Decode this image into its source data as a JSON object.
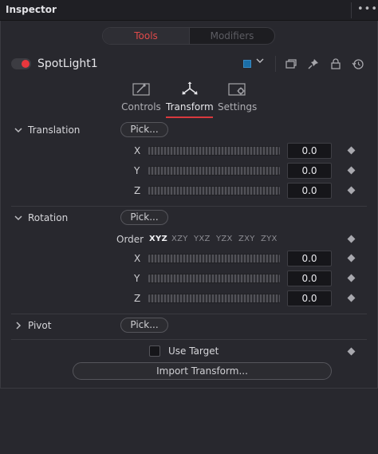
{
  "header": {
    "title": "Inspector",
    "menu": "•••"
  },
  "segmented": {
    "tools_label": "Tools",
    "modifiers_label": "Modifiers"
  },
  "node": {
    "name": "SpotLight1",
    "enabled": true,
    "chip_color": "#1b6fa8"
  },
  "sub_tabs": [
    {
      "label": "Controls",
      "icon": "controls-icon"
    },
    {
      "label": "Transform",
      "icon": "transform-icon",
      "active": true
    },
    {
      "label": "Settings",
      "icon": "settings-icon"
    }
  ],
  "translation": {
    "label": "Translation",
    "pick_label": "Pick...",
    "expanded": true,
    "rows": [
      {
        "axis": "X",
        "value": "0.0"
      },
      {
        "axis": "Y",
        "value": "0.0"
      },
      {
        "axis": "Z",
        "value": "0.0"
      }
    ]
  },
  "rotation": {
    "label": "Rotation",
    "pick_label": "Pick...",
    "expanded": true,
    "order_label": "Order",
    "order_options": [
      "XYZ",
      "XZY",
      "YXZ",
      "YZX",
      "ZXY",
      "ZYX"
    ],
    "order_selected": "XYZ",
    "rows": [
      {
        "axis": "X",
        "value": "0.0"
      },
      {
        "axis": "Y",
        "value": "0.0"
      },
      {
        "axis": "Z",
        "value": "0.0"
      }
    ]
  },
  "pivot": {
    "label": "Pivot",
    "pick_label": "Pick...",
    "expanded": false
  },
  "use_target": {
    "label": "Use Target",
    "checked": false
  },
  "import_transform": {
    "label": "Import Transform..."
  },
  "colors": {
    "accent": "#d9393e",
    "background": "#28282e",
    "panel_header": "#1f1f24"
  }
}
